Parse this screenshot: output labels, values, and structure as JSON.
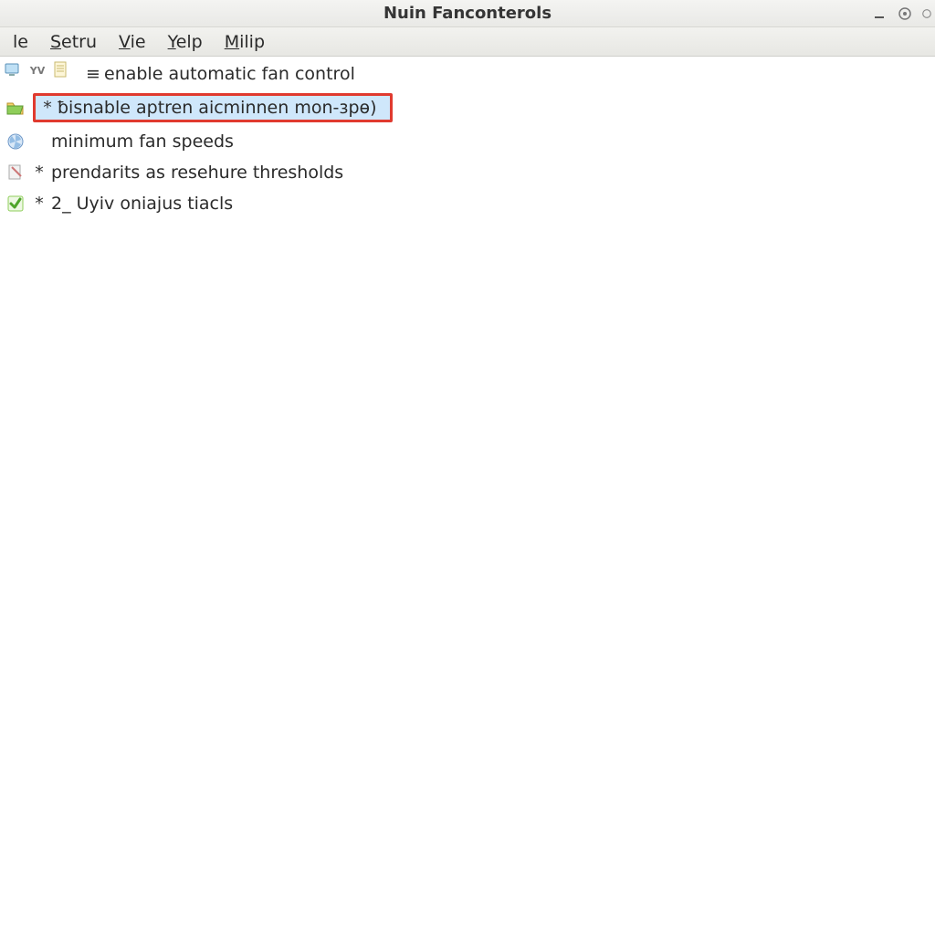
{
  "window": {
    "title": "Nuin Fanconterols"
  },
  "menu": {
    "items": [
      {
        "label": "le",
        "ul_index": -1
      },
      {
        "label": "Setru",
        "ul_index": 0
      },
      {
        "label": "Vie",
        "ul_index": 0
      },
      {
        "label": "Yelp",
        "ul_index": 0
      },
      {
        "label": "Milip",
        "ul_index": 0
      }
    ]
  },
  "list": {
    "items": [
      {
        "prefix": "≡",
        "label": "enable automatic fan control",
        "selected": false
      },
      {
        "prefix": "*",
        "label": "ƀisnable aptren aicminnen mon-ɜpɵ)",
        "selected": true
      },
      {
        "prefix": "",
        "label": "minimum fan speeds",
        "selected": false
      },
      {
        "prefix": "*",
        "label": "prendarits as resehure thresholds",
        "selected": false
      },
      {
        "prefix": "*",
        "label": "2_ Uyiv oniajus tiacls",
        "selected": false
      }
    ]
  }
}
